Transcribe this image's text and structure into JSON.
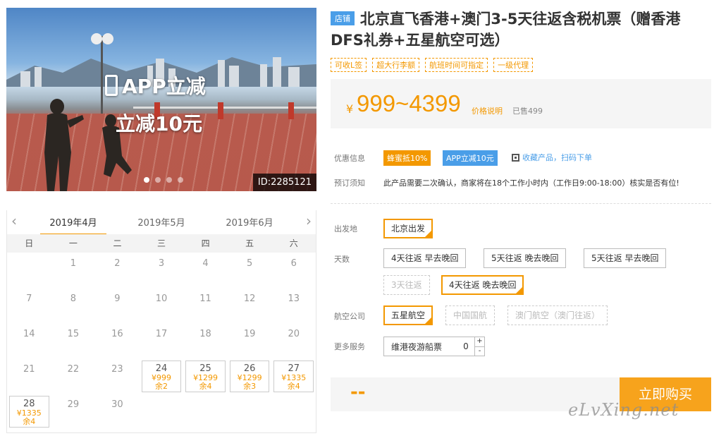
{
  "hero": {
    "promo_line1": "APP立减",
    "promo_line2_prefix": "立减",
    "promo_line2_amount": "10",
    "promo_line2_suffix": "元",
    "id_tag": "ID:2285121"
  },
  "calendar": {
    "months": [
      "2019年4月",
      "2019年5月",
      "2019年6月"
    ],
    "active_month_index": 0,
    "weekdays": [
      "日",
      "一",
      "二",
      "三",
      "四",
      "五",
      "六"
    ],
    "days": [
      {
        "d": ""
      },
      {
        "d": "1"
      },
      {
        "d": "2"
      },
      {
        "d": "3"
      },
      {
        "d": "4"
      },
      {
        "d": "5"
      },
      {
        "d": "6"
      },
      {
        "d": "7"
      },
      {
        "d": "8"
      },
      {
        "d": "9"
      },
      {
        "d": "10"
      },
      {
        "d": "11"
      },
      {
        "d": "12"
      },
      {
        "d": "13"
      },
      {
        "d": "14"
      },
      {
        "d": "15"
      },
      {
        "d": "16"
      },
      {
        "d": "17"
      },
      {
        "d": "18"
      },
      {
        "d": "19"
      },
      {
        "d": "20"
      },
      {
        "d": "21"
      },
      {
        "d": "22"
      },
      {
        "d": "23"
      },
      {
        "d": "24",
        "price": "¥999",
        "left": "余2"
      },
      {
        "d": "25",
        "price": "¥1299",
        "left": "余4"
      },
      {
        "d": "26",
        "price": "¥1299",
        "left": "余3"
      },
      {
        "d": "27",
        "price": "¥1335",
        "left": "余4"
      },
      {
        "d": "28",
        "price": "¥1335",
        "left": "余4"
      },
      {
        "d": "29"
      },
      {
        "d": "30"
      }
    ]
  },
  "product": {
    "shop_badge": "店铺",
    "title": "北京直飞香港+澳门3-5天往返含税机票（赠香港DFS礼券+五星航空可选）",
    "tags": [
      "可收L签",
      "超大行李额",
      "航班时间可指定",
      "一级代理"
    ],
    "price_currency": "¥",
    "price_range": "999~4399",
    "price_explain": "价格说明",
    "sold": "已售499"
  },
  "info": {
    "discount_label": "优惠信息",
    "discount_1": "蜂蜜抵10%",
    "discount_2": "APP立减10元",
    "qr_text": "收藏产品，扫码下单",
    "notice_label": "预订须知",
    "notice_text": "此产品需要二次确认，商家将在18个工作小时内（工作日9:00-18:00）核实是否有位!"
  },
  "options": {
    "departure_label": "出发地",
    "departure": "北京出发",
    "days_label": "天数",
    "days": [
      "4天往返 早去晚回",
      "5天往返 晚去晚回",
      "5天往返 早去晚回",
      "3天往返",
      "4天往返 晚去晚回"
    ],
    "airline_label": "航空公司",
    "airlines": [
      "五星航空",
      "中国国航",
      "澳门航空（澳门往返）"
    ],
    "services_label": "更多服务",
    "service_name": "维港夜游船票",
    "service_qty": "0",
    "plus": "+",
    "minus": "-"
  },
  "checkout": {
    "total": "--",
    "buy_label": "立即购买",
    "watermark": "eLvXing.net"
  },
  "colors": {
    "accent": "#f39800",
    "blue": "#4a9ee8"
  }
}
